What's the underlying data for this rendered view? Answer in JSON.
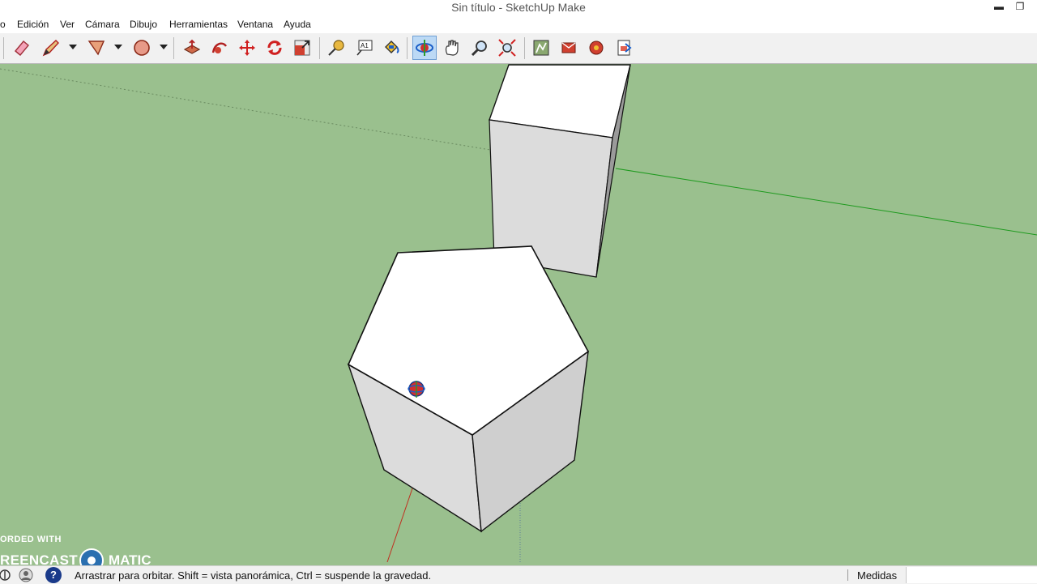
{
  "window": {
    "title": "Sin título - SketchUp Make",
    "minimize_glyph": "▬",
    "restore_glyph": "❐"
  },
  "menubar": {
    "items": [
      "o",
      "Edición",
      "Ver",
      "Cámara",
      "Dibujo",
      "Herramientas",
      "Ventana",
      "Ayuda"
    ]
  },
  "toolbar": {
    "tools": [
      {
        "name": "eraser-icon"
      },
      {
        "name": "pencil-icon"
      },
      {
        "name": "rectangle-icon"
      },
      {
        "name": "circle-icon"
      },
      {
        "name": "push-pull-icon"
      },
      {
        "name": "follow-me-icon"
      },
      {
        "name": "move-icon"
      },
      {
        "name": "rotate-icon"
      },
      {
        "name": "scale-icon"
      },
      {
        "name": "tape-measure-icon"
      },
      {
        "name": "text-icon"
      },
      {
        "name": "paint-bucket-icon"
      },
      {
        "name": "orbit-icon",
        "active": true
      },
      {
        "name": "pan-icon"
      },
      {
        "name": "zoom-icon"
      },
      {
        "name": "zoom-extents-icon"
      },
      {
        "name": "warehouse-icon"
      },
      {
        "name": "share-model-icon"
      },
      {
        "name": "extension-warehouse-icon"
      },
      {
        "name": "send-to-layout-icon"
      }
    ],
    "text_tool_glyph": "A1"
  },
  "colors": {
    "viewport_bg": "#9ac08e",
    "axis_green": "#1e9a1e",
    "axis_red": "#c03020",
    "face_top": "#ffffff",
    "face_side": "#dcdcdc",
    "face_side_dark": "#c9c9c9",
    "selected_tool": "#bcd9f5"
  },
  "statusbar": {
    "hint": "Arrastrar para orbitar. Shift = vista panorámica, Ctrl = suspende la gravedad.",
    "measurements_label": "Medidas",
    "measurements_value": "",
    "help_glyph": "?"
  },
  "watermark": {
    "line1": "ORDED WITH",
    "line2_left": "REENCAST",
    "line2_right": "MATIC"
  }
}
